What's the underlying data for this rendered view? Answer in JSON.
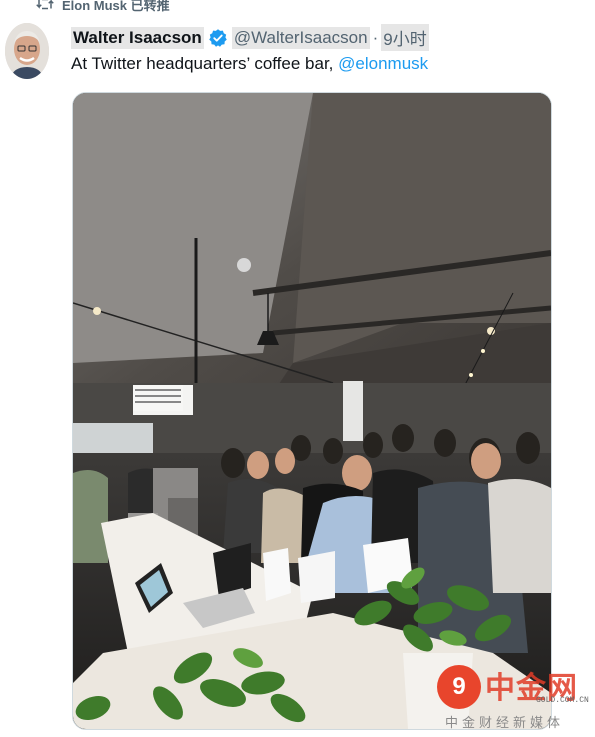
{
  "retweet": {
    "label": "Elon Musk 已转推"
  },
  "tweet": {
    "author_name": "Walter Isaacson",
    "handle": "@WalterIsaacson",
    "separator": "·",
    "time": "9小时",
    "text": "At Twitter headquarters’ coffee bar,",
    "mention": "@elonmusk"
  },
  "icons": {
    "retweet": "retweet-icon",
    "verified": "verified-badge-icon",
    "avatar": "avatar"
  },
  "watermark": {
    "title": "中金网",
    "url": "GOLD.COM.CN",
    "subtitle": "中金财经新媒体"
  },
  "colors": {
    "link": "#1d9bf0",
    "verified": "#1d9bf0",
    "secondary_text": "#536471",
    "watermark_red": "#e8452c"
  }
}
